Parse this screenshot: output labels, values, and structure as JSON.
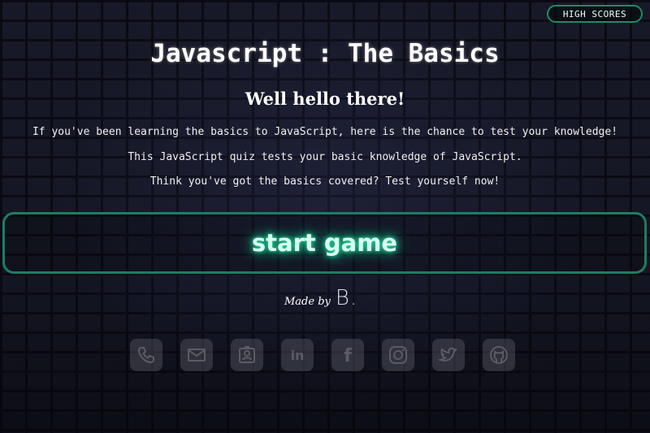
{
  "header": {
    "high_scores_label": "HIGH SCORES"
  },
  "main": {
    "title": "Javascript : The Basics",
    "subtitle": "Well hello there!",
    "lines": [
      "If you've been learning the basics to JavaScript, here is the chance to test your knowledge!",
      "This JavaScript quiz tests your basic knowledge of JavaScript.",
      "Think you've got the basics covered? Test yourself now!"
    ],
    "start_label": "start game"
  },
  "footer": {
    "made_by": "Made by",
    "logo": "B.",
    "socials": [
      "phone-icon",
      "mail-icon",
      "contact-card-icon",
      "linkedin-icon",
      "facebook-icon",
      "instagram-icon",
      "twitter-icon",
      "github-icon"
    ]
  },
  "colors": {
    "accent": "#1f8a6a",
    "glow": "#26e3a6"
  }
}
